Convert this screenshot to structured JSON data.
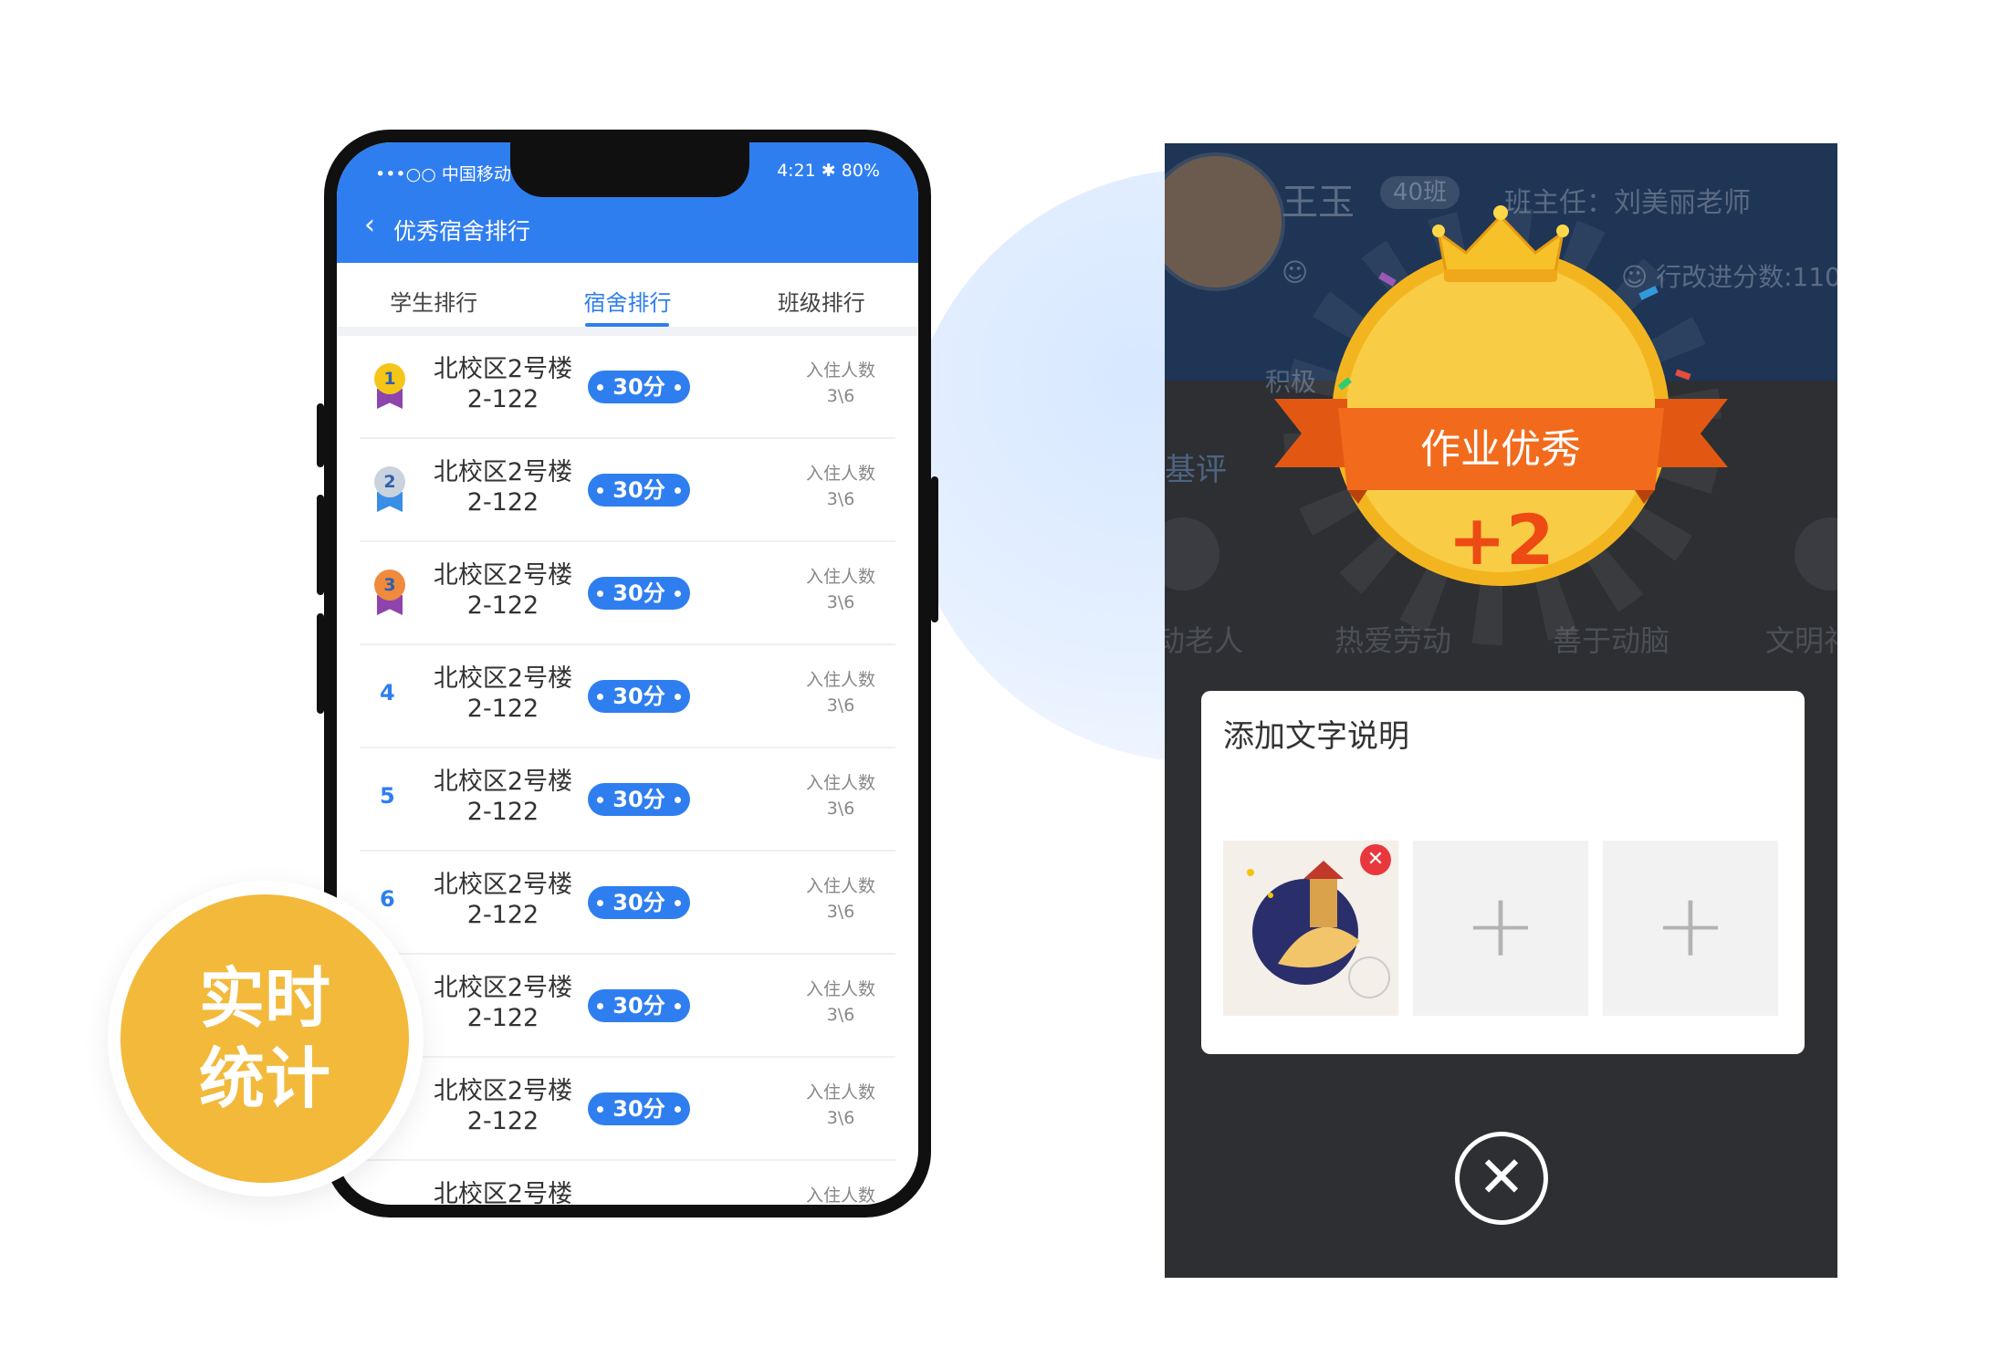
{
  "phone": {
    "status": {
      "carrier": "•••○○ 中国移动 ᯤ",
      "right": "4:21 ✱ 80%"
    },
    "nav": {
      "back_icon": "‹",
      "title": "优秀宿舍排行"
    },
    "tabs": [
      {
        "label": "学生排行"
      },
      {
        "label": "宿舍排行"
      },
      {
        "label": "班级排行"
      }
    ],
    "rows": [
      {
        "rank": "1",
        "dorm_line1": "北校区2号楼",
        "dorm_line2": "2-122",
        "score": "30分",
        "occ_label": "入住人数",
        "occ_value": "3\\6"
      },
      {
        "rank": "2",
        "dorm_line1": "北校区2号楼",
        "dorm_line2": "2-122",
        "score": "30分",
        "occ_label": "入住人数",
        "occ_value": "3\\6"
      },
      {
        "rank": "3",
        "dorm_line1": "北校区2号楼",
        "dorm_line2": "2-122",
        "score": "30分",
        "occ_label": "入住人数",
        "occ_value": "3\\6"
      },
      {
        "rank": "4",
        "dorm_line1": "北校区2号楼",
        "dorm_line2": "2-122",
        "score": "30分",
        "occ_label": "入住人数",
        "occ_value": "3\\6"
      },
      {
        "rank": "5",
        "dorm_line1": "北校区2号楼",
        "dorm_line2": "2-122",
        "score": "30分",
        "occ_label": "入住人数",
        "occ_value": "3\\6"
      },
      {
        "rank": "6",
        "dorm_line1": "北校区2号楼",
        "dorm_line2": "2-122",
        "score": "30分",
        "occ_label": "入住人数",
        "occ_value": "3\\6"
      },
      {
        "rank": "",
        "dorm_line1": "北校区2号楼",
        "dorm_line2": "2-122",
        "score": "30分",
        "occ_label": "入住人数",
        "occ_value": "3\\6"
      },
      {
        "rank": "",
        "dorm_line1": "北校区2号楼",
        "dorm_line2": "2-122",
        "score": "30分",
        "occ_label": "入住人数",
        "occ_value": "3\\6"
      },
      {
        "rank": "",
        "dorm_line1": "北校区2号楼",
        "dorm_line2": "",
        "score": "",
        "occ_label": "入住人数",
        "occ_value": ""
      }
    ],
    "medal_colors": [
      "#f5c518",
      "#c9d3de",
      "#f08a3c"
    ],
    "ribbon_colors": [
      "#8e44ad",
      "#3a8ee6",
      "#8e44ad"
    ]
  },
  "badge": {
    "line1": "实时",
    "line2": "统计"
  },
  "panel": {
    "student_name": "王玉",
    "class_tag": "40班",
    "teacher": "班主任：刘美丽老师",
    "smile_icon": "☺",
    "score_text": "☺ 行改进分数:110",
    "tab1": "积极",
    "tab2": "基评",
    "categories": [
      "动老人",
      "热爱劳动",
      "善于动脑",
      "文明礼"
    ],
    "award_title": "作业优秀",
    "award_points": "+2",
    "dialog": {
      "title": "添加文字说明",
      "remove_icon": "✕",
      "add_icon": "+"
    },
    "close_icon": "✕",
    "colors": {
      "ribbon": "#f26b1d",
      "coin": "#f3b51f",
      "points": "#ee4a14",
      "remove": "#e8383d"
    }
  }
}
